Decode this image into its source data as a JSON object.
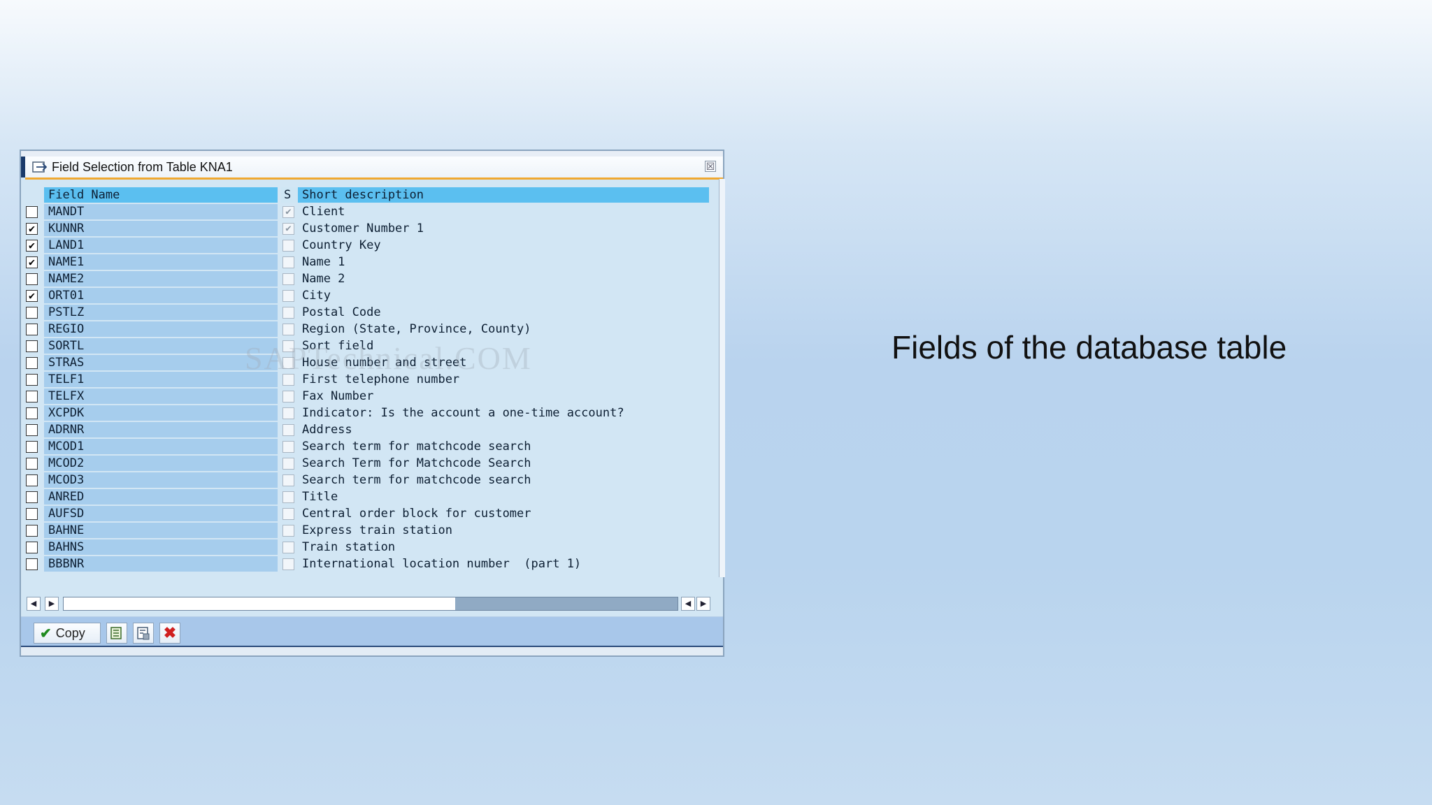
{
  "slide": {
    "caption": "Fields of the database table"
  },
  "dialog": {
    "title": "Field Selection from Table KNA1",
    "close_symbol": "☒",
    "watermark": "SAPTechnical.COM",
    "columns": {
      "field": "Field Name",
      "s": "S",
      "desc": "Short description"
    },
    "rows": [
      {
        "field": "MANDT",
        "desc": "Client",
        "selected": false,
        "s_checked": true
      },
      {
        "field": "KUNNR",
        "desc": "Customer Number 1",
        "selected": true,
        "s_checked": true
      },
      {
        "field": "LAND1",
        "desc": "Country Key",
        "selected": true,
        "s_checked": false
      },
      {
        "field": "NAME1",
        "desc": "Name 1",
        "selected": true,
        "s_checked": false
      },
      {
        "field": "NAME2",
        "desc": "Name 2",
        "selected": false,
        "s_checked": false
      },
      {
        "field": "ORT01",
        "desc": "City",
        "selected": true,
        "s_checked": false
      },
      {
        "field": "PSTLZ",
        "desc": "Postal Code",
        "selected": false,
        "s_checked": false
      },
      {
        "field": "REGIO",
        "desc": "Region (State, Province, County)",
        "selected": false,
        "s_checked": false
      },
      {
        "field": "SORTL",
        "desc": "Sort field",
        "selected": false,
        "s_checked": false
      },
      {
        "field": "STRAS",
        "desc": "House number and street",
        "selected": false,
        "s_checked": false
      },
      {
        "field": "TELF1",
        "desc": "First telephone number",
        "selected": false,
        "s_checked": false
      },
      {
        "field": "TELFX",
        "desc": "Fax Number",
        "selected": false,
        "s_checked": false
      },
      {
        "field": "XCPDK",
        "desc": "Indicator: Is the account a one-time account?",
        "selected": false,
        "s_checked": false
      },
      {
        "field": "ADRNR",
        "desc": "Address",
        "selected": false,
        "s_checked": false
      },
      {
        "field": "MCOD1",
        "desc": "Search term for matchcode search",
        "selected": false,
        "s_checked": false
      },
      {
        "field": "MCOD2",
        "desc": "Search Term for Matchcode Search",
        "selected": false,
        "s_checked": false
      },
      {
        "field": "MCOD3",
        "desc": "Search term for matchcode search",
        "selected": false,
        "s_checked": false
      },
      {
        "field": "ANRED",
        "desc": "Title",
        "selected": false,
        "s_checked": false
      },
      {
        "field": "AUFSD",
        "desc": "Central order block for customer",
        "selected": false,
        "s_checked": false
      },
      {
        "field": "BAHNE",
        "desc": "Express train station",
        "selected": false,
        "s_checked": false
      },
      {
        "field": "BAHNS",
        "desc": "Train station",
        "selected": false,
        "s_checked": false
      },
      {
        "field": "BBBNR",
        "desc": "International location number  (part 1)",
        "selected": false,
        "s_checked": false
      }
    ],
    "toolbar": {
      "copy_label": "Copy"
    }
  }
}
